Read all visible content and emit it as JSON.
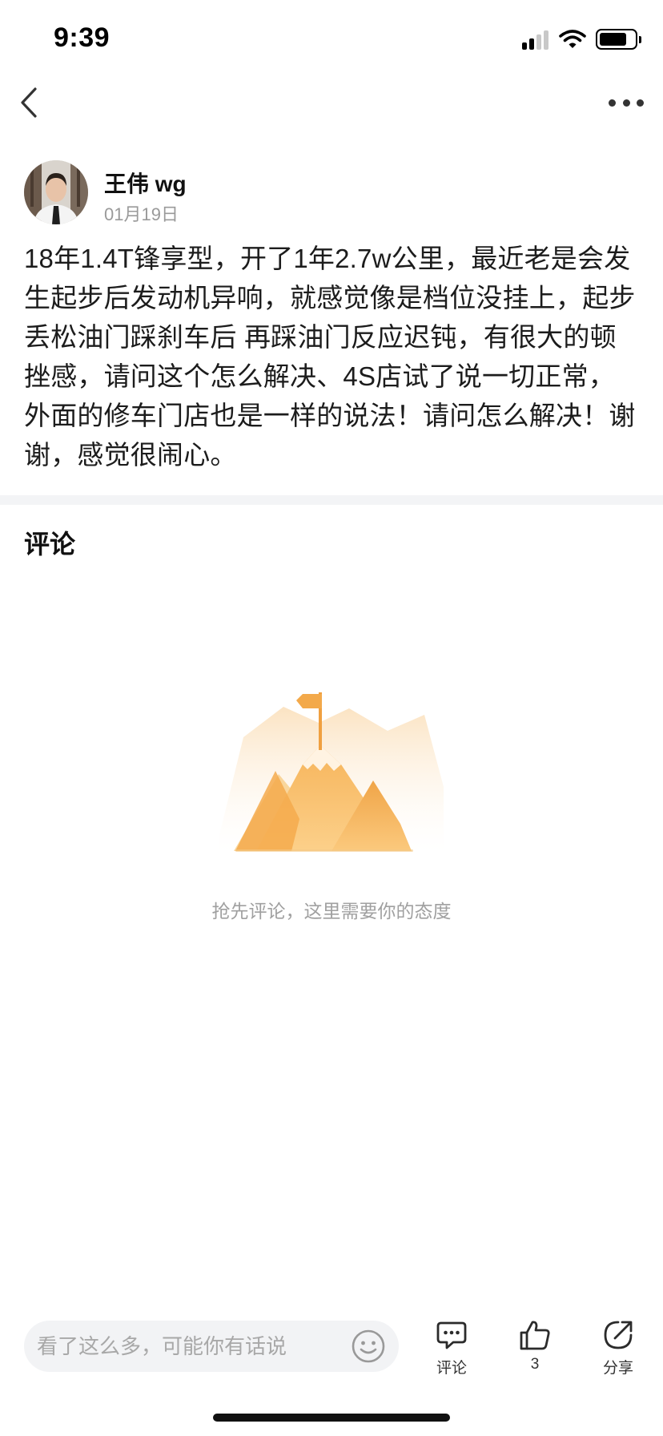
{
  "status_bar": {
    "time": "9:39",
    "icons": [
      "signal-icon",
      "wifi-icon",
      "battery-icon"
    ],
    "battery_level": 0.8
  },
  "nav": {
    "back_icon": "chevron-left-icon",
    "more_icon": "more-dots-icon"
  },
  "post": {
    "author_name": "王伟 wg",
    "date": "01月19日",
    "body": "18年1.4T锋享型，开了1年2.7w公里，最近老是会发生起步后发动机异响，就感觉像是档位没挂上，起步丢松油门踩刹车后 再踩油门反应迟钝，有很大的顿挫感，请问这个怎么解决、4S店试了说一切正常，外面的修车门店也是一样的说法！请问怎么解决！谢谢，感觉很闹心。"
  },
  "comments": {
    "title": "评论",
    "empty_text": "抢先评论，这里需要你的态度",
    "empty_icon": "mountain-flag-icon"
  },
  "bottom_bar": {
    "input_placeholder": "看了这么多，可能你有话说",
    "input_value": "",
    "emoji_icon": "smiley-icon",
    "actions": [
      {
        "icon": "comment-icon",
        "label": "评论"
      },
      {
        "icon": "thumbs-up-icon",
        "label": "3"
      },
      {
        "icon": "share-icon",
        "label": "分享"
      }
    ]
  },
  "colors": {
    "accent_illustration": "#f6b95a",
    "muted_text": "#9a9a9a",
    "divider": "#f3f4f6",
    "input_background": "#f2f3f5"
  }
}
